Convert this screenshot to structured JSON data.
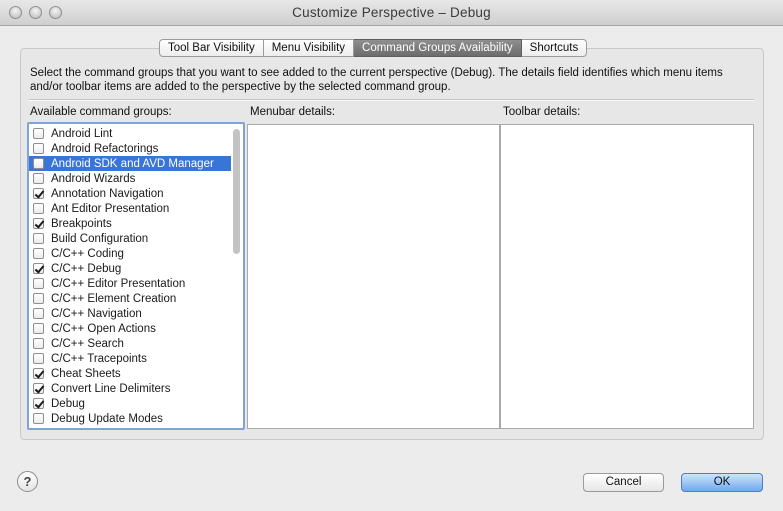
{
  "window": {
    "title": "Customize Perspective – Debug"
  },
  "tabs": [
    {
      "label": "Tool Bar Visibility",
      "active": false
    },
    {
      "label": "Menu Visibility",
      "active": false
    },
    {
      "label": "Command Groups Availability",
      "active": true
    },
    {
      "label": "Shortcuts",
      "active": false
    }
  ],
  "description": "Select the command groups that you want to see added to the current perspective (Debug).  The details field identifies which menu items and/or toolbar items are added to the perspective by the selected command group.",
  "available": {
    "label": "Available command groups:",
    "items": [
      {
        "label": "Android Lint",
        "checked": false,
        "selected": false
      },
      {
        "label": "Android Refactorings",
        "checked": false,
        "selected": false
      },
      {
        "label": "Android SDK and AVD Manager",
        "checked": false,
        "selected": true
      },
      {
        "label": "Android Wizards",
        "checked": false,
        "selected": false
      },
      {
        "label": "Annotation Navigation",
        "checked": true,
        "selected": false
      },
      {
        "label": "Ant Editor Presentation",
        "checked": false,
        "selected": false
      },
      {
        "label": "Breakpoints",
        "checked": true,
        "selected": false
      },
      {
        "label": "Build Configuration",
        "checked": false,
        "selected": false
      },
      {
        "label": "C/C++ Coding",
        "checked": false,
        "selected": false
      },
      {
        "label": "C/C++ Debug",
        "checked": true,
        "selected": false
      },
      {
        "label": "C/C++ Editor Presentation",
        "checked": false,
        "selected": false
      },
      {
        "label": "C/C++ Element Creation",
        "checked": false,
        "selected": false
      },
      {
        "label": "C/C++ Navigation",
        "checked": false,
        "selected": false
      },
      {
        "label": "C/C++ Open Actions",
        "checked": false,
        "selected": false
      },
      {
        "label": "C/C++ Search",
        "checked": false,
        "selected": false
      },
      {
        "label": "C/C++ Tracepoints",
        "checked": false,
        "selected": false
      },
      {
        "label": "Cheat Sheets",
        "checked": true,
        "selected": false
      },
      {
        "label": "Convert Line Delimiters",
        "checked": true,
        "selected": false
      },
      {
        "label": "Debug",
        "checked": true,
        "selected": false
      },
      {
        "label": "Debug Update Modes",
        "checked": false,
        "selected": false
      }
    ]
  },
  "menubar_details": {
    "label": "Menubar details:"
  },
  "toolbar_details": {
    "label": "Toolbar details:"
  },
  "buttons": {
    "help": "?",
    "cancel": "Cancel",
    "ok": "OK"
  },
  "colors": {
    "selection": "#3875d7",
    "focus_ring": "#7ea3d4",
    "default_button": "#6fa9ee"
  }
}
